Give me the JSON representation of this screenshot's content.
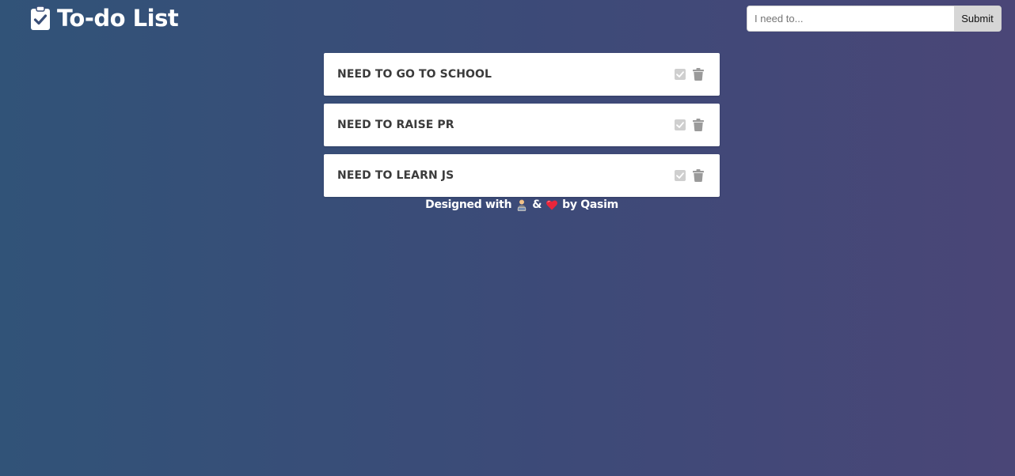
{
  "header": {
    "title": "To-do List",
    "logo_icon": "clipboard-check-icon"
  },
  "form": {
    "input_placeholder": "I need to...",
    "input_value": "",
    "submit_label": "Submit"
  },
  "todos": [
    {
      "text": "NEED TO GO TO SCHOOL",
      "done_icon": "check-square-icon",
      "delete_icon": "trash-icon"
    },
    {
      "text": "NEED TO RAISE PR",
      "done_icon": "check-square-icon",
      "delete_icon": "trash-icon"
    },
    {
      "text": "NEED TO LEARN JS",
      "done_icon": "check-square-icon",
      "delete_icon": "trash-icon"
    }
  ],
  "footer": {
    "prefix": "Designed with",
    "emoji_1": "technologist-icon",
    "ampersand": "&",
    "emoji_2": "heart-icon",
    "suffix": "by Qasim"
  },
  "colors": {
    "background_start": "#315378",
    "background_end": "#4a4677",
    "card": "#ffffff",
    "todo_text": "#3b3b3b",
    "check_icon": "#cfcfcf",
    "trash_icon": "#9a9a9a",
    "submit_button": "#d6d6d6",
    "heart": "#e8263b"
  }
}
